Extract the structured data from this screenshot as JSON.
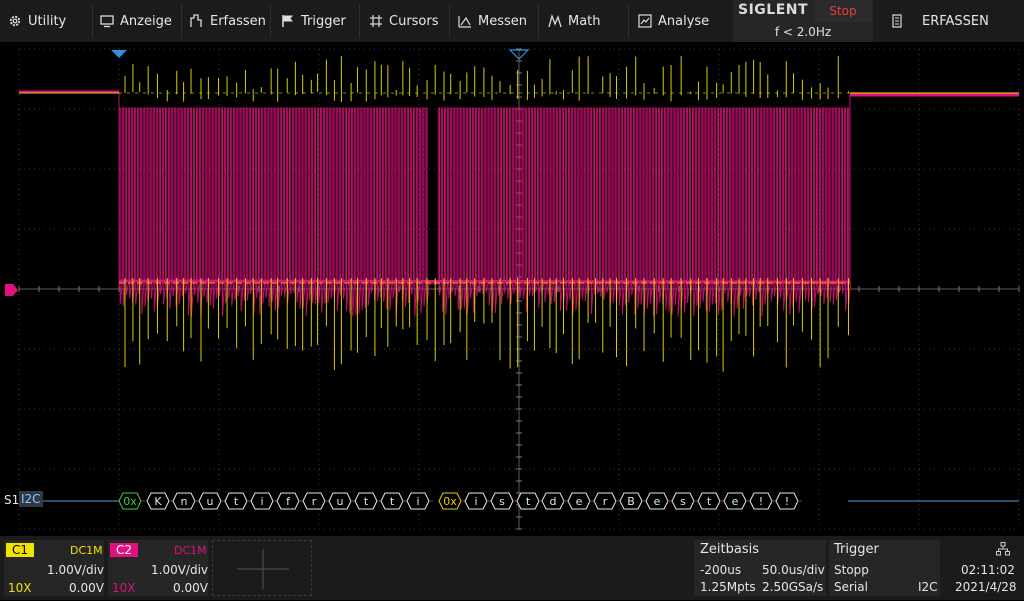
{
  "menu": {
    "utility": "Utility",
    "anzeige": "Anzeige",
    "erfassen": "Erfassen",
    "trigger": "Trigger",
    "cursors": "Cursors",
    "messen": "Messen",
    "math": "Math",
    "analyse": "Analyse",
    "right_label": "ERFASSEN"
  },
  "header": {
    "brand": "SIGLENT",
    "run_state": "Stop",
    "frequency": "f < 2.0Hz"
  },
  "decoder": {
    "label_s1": "S1",
    "label_proto": "I2C",
    "frames": [
      "0x",
      "K",
      "n",
      "u",
      "t",
      "i",
      "f",
      "r",
      "u",
      "t",
      "t",
      "i",
      "0x",
      "i",
      "s",
      "t",
      "d",
      "e",
      "r",
      "B",
      "e",
      "s",
      "t",
      "e",
      "!",
      "!"
    ]
  },
  "channels": {
    "c1": {
      "name": "C1",
      "coupling": "DC1M",
      "scale": "1.00V/div",
      "probe": "10X",
      "offset": "0.00V",
      "color": "#f1e300"
    },
    "c2": {
      "name": "C2",
      "coupling": "DC1M",
      "scale": "1.00V/div",
      "probe": "10X",
      "offset": "0.00V",
      "color": "#e0107e"
    }
  },
  "timebase": {
    "title": "Zeitbasis",
    "delay": "-200us",
    "scale": "50.0us/div",
    "memory": "1.25Mpts",
    "sample_rate": "2.50GSa/s"
  },
  "trigger": {
    "title": "Trigger",
    "state": "Stopp",
    "type": "Serial",
    "source": "I2C"
  },
  "clock": {
    "time": "02:11:02",
    "date": "2021/4/28"
  },
  "colors": {
    "ch1": "#f1e300",
    "ch2": "#e0107e",
    "decode_line": "#4aa0e0",
    "accent": "#e8413b"
  }
}
